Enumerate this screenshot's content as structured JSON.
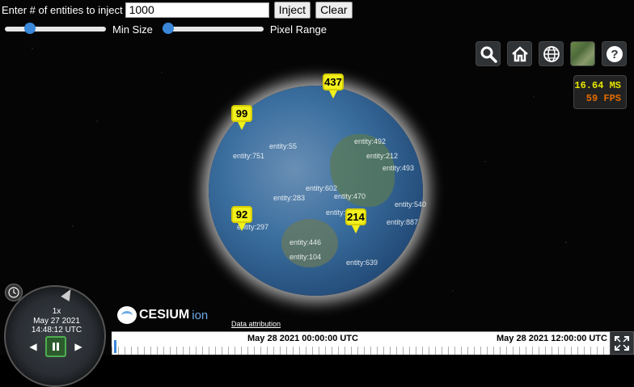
{
  "toolbar": {
    "inject_label": "Enter # of entities to inject",
    "inject_value": "1000",
    "inject_button": "Inject",
    "clear_button": "Clear",
    "min_size_label": "Min Size",
    "pixel_range_label": "Pixel Range",
    "min_size_level": 0.25,
    "pixel_range_level": 0.1
  },
  "controls": [
    {
      "name": "geocoder-search-button",
      "icon": "search-icon"
    },
    {
      "name": "home-button",
      "icon": "home-icon"
    },
    {
      "name": "scene-mode-picker-button",
      "icon": "globe-icon"
    },
    {
      "name": "base-layer-picker-button",
      "icon": "imagery-thumbnail-icon"
    },
    {
      "name": "help-button",
      "icon": "question-icon"
    }
  ],
  "performance": {
    "ms": "16.64 MS",
    "fps": "59 FPS",
    "ms_color": "#e5e500",
    "fps_color": "#e56c00"
  },
  "clusters": [
    {
      "label": "437"
    },
    {
      "label": "99"
    },
    {
      "label": "92"
    },
    {
      "label": "214"
    }
  ],
  "entity_labels": [
    "entity:55",
    "entity:751",
    "entity:492",
    "entity:602",
    "entity:470",
    "entity:283",
    "entity:297",
    "entity:446",
    "entity:104",
    "entity:639",
    "entity:346",
    "entity:887",
    "entity:493",
    "entity:540",
    "entity:212"
  ],
  "animation": {
    "speed": "1x",
    "date": "May 27 2021",
    "time": "14:48:12 UTC"
  },
  "logo": {
    "name": "CESIUM",
    "suffix": "ion"
  },
  "attribution": "Data attribution",
  "timeline": {
    "label_1": "May 28 2021 00:00:00 UTC",
    "label_2": "May 28 2021 12:00:00 UTC"
  }
}
